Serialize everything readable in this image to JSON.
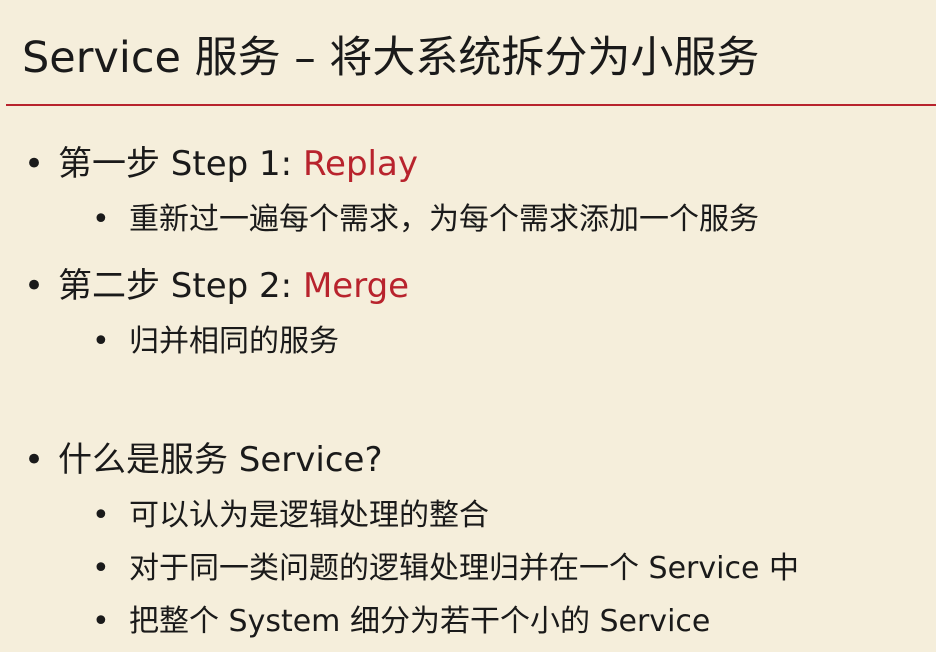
{
  "title": "Service 服务 – 将大系统拆分为小服务",
  "bullets": [
    {
      "prefix": "第一步 Step 1: ",
      "highlight": "Replay",
      "sub": "重新过一遍每个需求，为每个需求添加一个服务"
    },
    {
      "prefix": "第二步 Step 2: ",
      "highlight": "Merge",
      "sub": "归并相同的服务"
    },
    {
      "text": "什么是服务 Service?",
      "subs": [
        "可以认为是逻辑处理的整合",
        "对于同一类问题的逻辑处理归并在一个 Service 中",
        "把整个 System 细分为若干个小的 Service"
      ]
    }
  ],
  "colors": {
    "background": "#f5eedb",
    "accent": "#b8232d",
    "text": "#1a1a1a"
  }
}
